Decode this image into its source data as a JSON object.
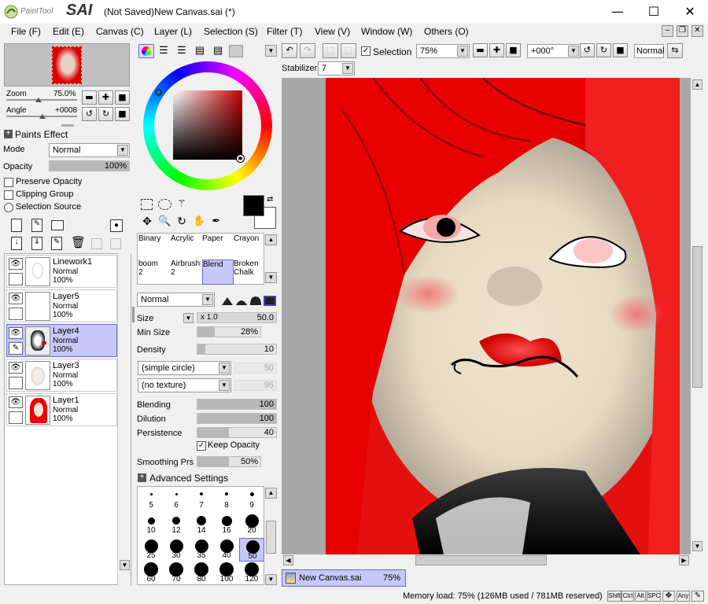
{
  "window": {
    "logo_small": "PaintTool",
    "logo_big": "SAI",
    "title": "(Not Saved)New Canvas.sai (*)",
    "minimize": "—",
    "maximize": "☐",
    "close": "✕"
  },
  "menu": [
    "File (F)",
    "Edit (E)",
    "Canvas (C)",
    "Layer (L)",
    "Selection (S)",
    "Filter (T)",
    "View (V)",
    "Window (W)",
    "Others (O)"
  ],
  "navigator": {
    "zoom_label": "Zoom",
    "zoom_value": "75.0%",
    "angle_label": "Angle",
    "angle_value": "+0008"
  },
  "layer_panel": {
    "paints_effect": "Paints Effect",
    "mode_label": "Mode",
    "mode_value": "Normal",
    "opacity_label": "Opacity",
    "opacity_value": "100%",
    "opacity_level": 1.0,
    "preserve_opacity": "Preserve Opacity",
    "clipping_group": "Clipping Group",
    "selection_source": "Selection Source",
    "layers": [
      {
        "name": "Linework1",
        "mode": "Normal",
        "opacity": "100%",
        "selected": false
      },
      {
        "name": "Layer5",
        "mode": "Normal",
        "opacity": "100%",
        "selected": false
      },
      {
        "name": "Layer4",
        "mode": "Normal",
        "opacity": "100%",
        "selected": true
      },
      {
        "name": "Layer3",
        "mode": "Normal",
        "opacity": "100%",
        "selected": false
      },
      {
        "name": "Layer1",
        "mode": "Normal",
        "opacity": "100%",
        "selected": false
      }
    ]
  },
  "colors": {
    "primary": "#000000",
    "secondary": "#ffffff",
    "accent_hue": "#c40000",
    "selected_layer_bg": "#c8c8f8"
  },
  "tools": {
    "brushes": [
      {
        "name": "Binary",
        "sub": ""
      },
      {
        "name": "Acrylic",
        "sub": ""
      },
      {
        "name": "Paper",
        "sub": ""
      },
      {
        "name": "Crayon",
        "sub": ""
      },
      {
        "name": "boom",
        "sub": "2"
      },
      {
        "name": "Airbrush",
        "sub": "2"
      },
      {
        "name": "Blend",
        "sub": ""
      },
      {
        "name": "Broken",
        "sub": "Chalk"
      }
    ],
    "selected_brush": "Blend",
    "blend_mode": "Normal",
    "size_label": "Size",
    "size_mult": "x 1.0",
    "size_value": "50.0",
    "min_size_label": "Min Size",
    "min_size_value": "28%",
    "min_size_level": 0.28,
    "density_label": "Density",
    "density_value": "10",
    "density_level": 0.1,
    "shape_value": "(simple circle)",
    "shape_strength": "50",
    "texture_value": "(no texture)",
    "texture_strength": "95",
    "blending_label": "Blending",
    "blending_value": "100",
    "dilution_label": "Dilution",
    "dilution_value": "100",
    "persistence_label": "Persistence",
    "persistence_value": "40",
    "persistence_level": 0.4,
    "keep_opacity": "Keep Opacity",
    "smoothing_label": "Smoothing Prs",
    "smoothing_value": "50%",
    "advanced": "Advanced Settings",
    "brush_sizes": [
      "5",
      "6",
      "7",
      "8",
      "9",
      "10",
      "12",
      "14",
      "16",
      "20",
      "25",
      "30",
      "35",
      "40",
      "50",
      "60",
      "70",
      "80",
      "100",
      "120"
    ],
    "selected_size": "50"
  },
  "toolbar": {
    "selection_label": "Selection",
    "zoom_value": "75%",
    "angle_value": "+000°",
    "mode_value": "Normal",
    "stabilizer_label": "Stabilizer",
    "stabilizer_value": "7"
  },
  "status": {
    "tab_name": "New Canvas.sai",
    "tab_zoom": "75%",
    "memory": "Memory load: 75% (126MB used / 781MB reserved)",
    "keys": [
      "Shift",
      "Ctrl",
      "Alt",
      "SPC",
      "Any"
    ]
  }
}
